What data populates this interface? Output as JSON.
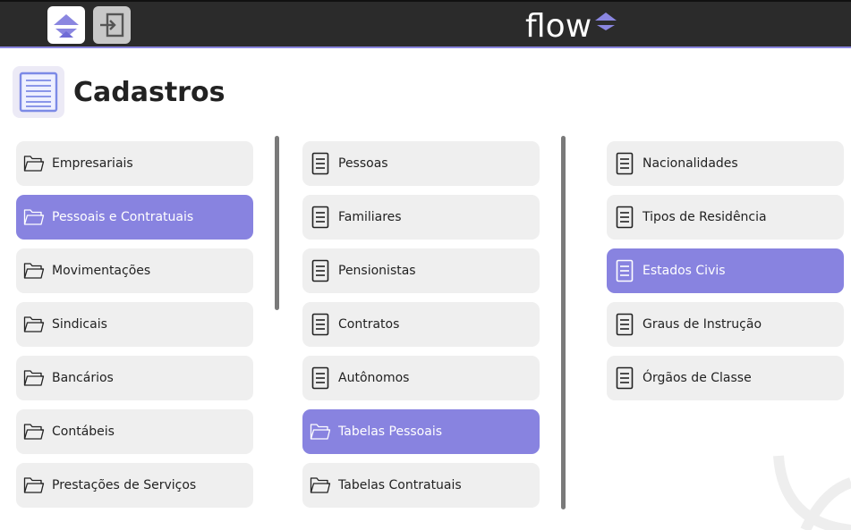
{
  "header": {
    "home_icon": "flow-logo-icon",
    "exit_icon": "exit-icon",
    "brand": "flow",
    "accent": "#8a86e0",
    "bar_color": "#2b2b2b"
  },
  "page": {
    "title": "Cadastros",
    "icon": "list-document-icon"
  },
  "colors": {
    "selected": "#8883e0",
    "item_bg": "#efefef"
  },
  "categories": [
    {
      "label": "Empresariais",
      "selected": false
    },
    {
      "label": "Pessoais e Contratuais",
      "selected": true
    },
    {
      "label": "Movimentações",
      "selected": false
    },
    {
      "label": "Sindicais",
      "selected": false
    },
    {
      "label": "Bancários",
      "selected": false
    },
    {
      "label": "Contábeis",
      "selected": false
    },
    {
      "label": "Prestações de Serviços",
      "selected": false
    }
  ],
  "subcategories": [
    {
      "label": "Pessoas",
      "icon": "document-icon",
      "selected": false
    },
    {
      "label": "Familiares",
      "icon": "document-icon",
      "selected": false
    },
    {
      "label": "Pensionistas",
      "icon": "document-icon",
      "selected": false
    },
    {
      "label": "Contratos",
      "icon": "document-icon",
      "selected": false
    },
    {
      "label": "Autônomos",
      "icon": "document-icon",
      "selected": false
    },
    {
      "label": "Tabelas Pessoais",
      "icon": "folder-icon",
      "selected": true
    },
    {
      "label": "Tabelas Contratuais",
      "icon": "folder-icon",
      "selected": false
    }
  ],
  "tables": [
    {
      "label": "Nacionalidades",
      "selected": false
    },
    {
      "label": "Tipos de Residência",
      "selected": false
    },
    {
      "label": "Estados Civis",
      "selected": true
    },
    {
      "label": "Graus de Instrução",
      "selected": false
    },
    {
      "label": "Órgãos de Classe",
      "selected": false
    }
  ]
}
